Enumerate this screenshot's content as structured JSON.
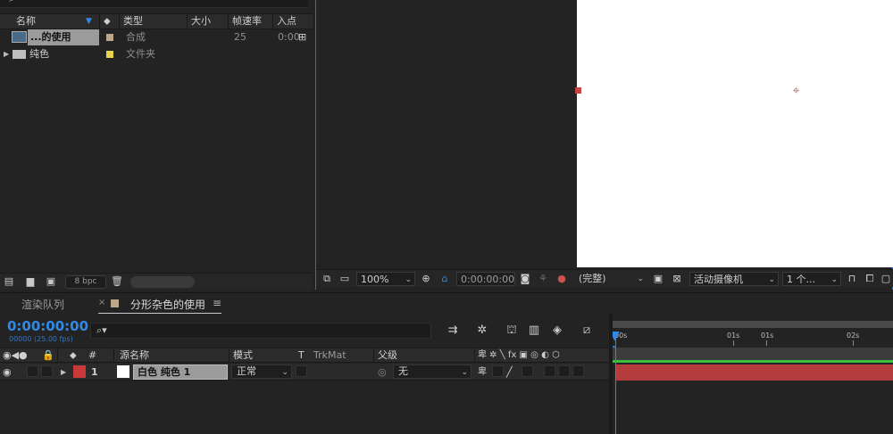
{
  "project": {
    "columns": {
      "name": "名称",
      "type": "类型",
      "size": "大小",
      "framerate": "帧速率",
      "in_point": "入点"
    },
    "items": [
      {
        "name": "...的使用",
        "type": "合成",
        "framerate": "25",
        "in_point": "0:00",
        "label_color": "#bda78a",
        "icon": "composition-icon"
      },
      {
        "name": "纯色",
        "type": "文件夹",
        "framerate": "",
        "in_point": "",
        "label_color": "#e8d44a",
        "icon": "folder-icon"
      }
    ],
    "footer": {
      "bit_depth": "8 bpc"
    }
  },
  "viewer": {
    "zoom": "100%",
    "timecode": "0:00:00:00",
    "resolution": "(完整)",
    "camera": "活动摄像机",
    "views": "1 个..."
  },
  "timeline": {
    "tabs": {
      "render_queue": "渲染队列",
      "comp": "分形杂色的使用",
      "close": "×",
      "menu": "≡"
    },
    "timecode": "0:00:00:00",
    "frame_info": "00000 (25.00 fps)",
    "ruler": {
      "labels": [
        "00s",
        "01s",
        "01s",
        "02s"
      ]
    },
    "columns": {
      "hash": "#",
      "source_name": "源名称",
      "mode": "模式",
      "t": "T",
      "trkmat": "TrkMat",
      "parent": "父级"
    },
    "layers": [
      {
        "index": "1",
        "name": "白色 纯色 1",
        "mode": "正常",
        "parent": "无",
        "label_color": "#c83a3a"
      }
    ]
  },
  "colors": {
    "accent_blue": "#2e8ae6",
    "layer_bar": "#b43c3c",
    "work_area_green": "#3cbf3c"
  }
}
